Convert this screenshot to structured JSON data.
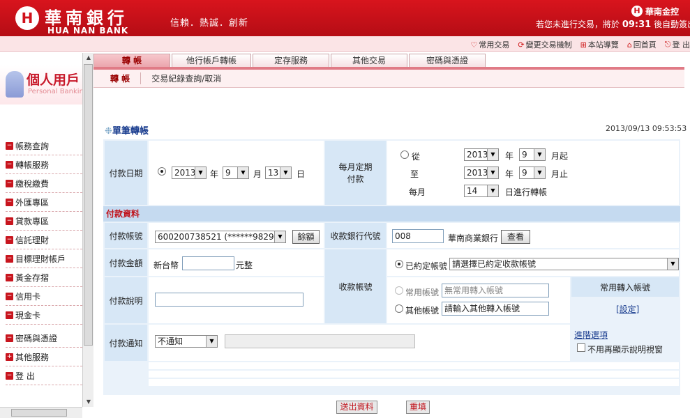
{
  "header": {
    "logo_mark": "H",
    "bank_name_cn": "華南銀行",
    "bank_name_en": "HUA NAN BANK",
    "slogan": "信賴．熱誠．創新",
    "group_name": "華南金控",
    "logout_prefix": "若您未進行交易，將於",
    "logout_time": "09:31",
    "logout_suffix": "後自動簽出",
    "links": [
      {
        "icon": "♡",
        "label": "常用交易"
      },
      {
        "icon": "⟳",
        "label": "變更交易機制"
      },
      {
        "icon": "⊞",
        "label": "本站導覽"
      },
      {
        "icon": "⌂",
        "label": "回首頁"
      },
      {
        "icon": "⎋",
        "label": "登  出"
      }
    ]
  },
  "sidebar": {
    "personal_title": "個人用戶",
    "personal_subtitle": "Personal Banking",
    "items": [
      {
        "label": "帳務查詢",
        "icon": "minus"
      },
      {
        "label": "轉帳服務",
        "icon": "minus"
      },
      {
        "label": "繳稅繳費",
        "icon": "minus"
      },
      {
        "label": "外匯專區",
        "icon": "minus"
      },
      {
        "label": "貸款專區",
        "icon": "minus"
      },
      {
        "label": "信託理財",
        "icon": "minus"
      },
      {
        "label": "目標理財帳戶",
        "icon": "minus"
      },
      {
        "label": "黃金存摺",
        "icon": "minus"
      },
      {
        "label": "信用卡",
        "icon": "minus"
      },
      {
        "label": "現金卡",
        "icon": "minus"
      },
      {
        "label": "密碼與憑證",
        "icon": "minus"
      },
      {
        "label": "其他服務",
        "icon": "plus"
      },
      {
        "label": "登  出",
        "icon": "minus"
      }
    ]
  },
  "tabs": [
    "轉  帳",
    "他行帳戶轉帳",
    "定存服務",
    "其他交易",
    "密碼與憑證"
  ],
  "subtabs": [
    "轉  帳",
    "交易紀錄查詢/取消"
  ],
  "page": {
    "title": "單筆轉帳",
    "datetime": "2013/09/13   09:53:53"
  },
  "form": {
    "pay_date_label": "付款日期",
    "pay_year": "2013",
    "pay_month": "9",
    "pay_day": "13",
    "unit_year": "年",
    "unit_month": "月",
    "unit_day": "日",
    "monthly_label_1": "每月定期",
    "monthly_label_2": "付款",
    "from_label": "從",
    "from_year": "2013",
    "from_month": "9",
    "from_suffix": "月起",
    "to_label": "至",
    "to_year": "2013",
    "to_month": "9",
    "to_suffix": "月止",
    "every_month_label": "每月",
    "every_day": "14",
    "every_suffix": "日進行轉帳",
    "section_title": "付款資料",
    "account_label": "付款帳號",
    "account_value": "600200738521   (******9829)",
    "balance_button": "餘額",
    "bank_code_label": "收款銀行代號",
    "bank_code_value": "008",
    "bank_name": "華南商業銀行",
    "view_button": "查看",
    "amount_label": "付款金額",
    "currency": "新台幣",
    "amount_value": "",
    "amount_unit": "元整",
    "payee_label": "收款帳號",
    "agreed_label": "已約定帳號",
    "agreed_select": "請選擇已約定收款帳號",
    "common_label": "常用帳號",
    "common_placeholder": "無常用轉入帳號",
    "other_label": "其他帳號",
    "other_placeholder": "請輸入其他轉入帳號",
    "common_in_title": "常用轉入帳號",
    "set_link": "[設定]",
    "memo_label": "付款說明",
    "memo_value": "",
    "notify_label": "付款通知",
    "notify_value": "不通知",
    "notify_input": "",
    "advanced_link": "進階選項",
    "no_show_label": "不用再顯示說明視窗"
  },
  "buttons": {
    "submit": "送出資料",
    "reset": "重填"
  },
  "colors": {
    "brand_red": "#d0101a",
    "label_blue": "#d7e7f6",
    "title_blue": "#1a3d8f"
  }
}
